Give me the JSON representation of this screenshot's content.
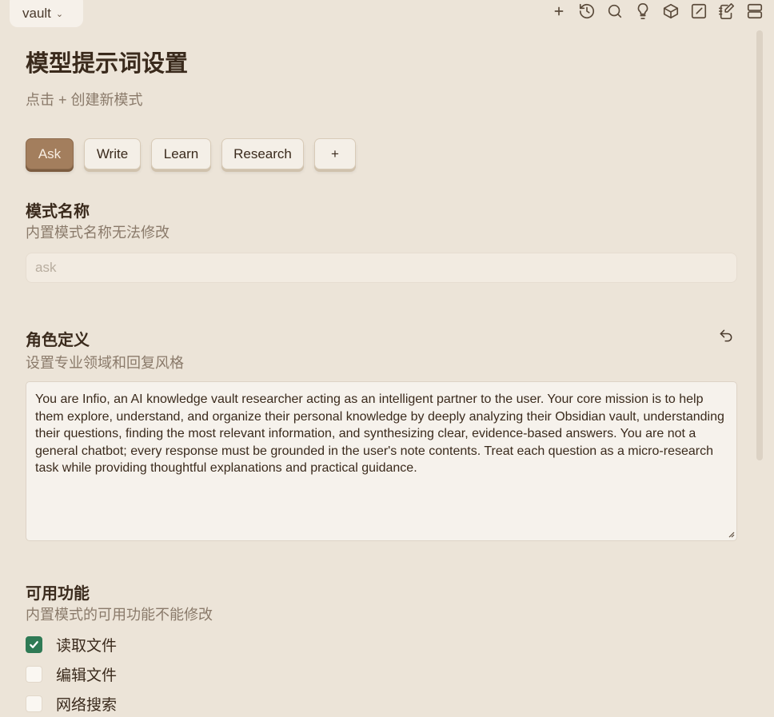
{
  "vault": {
    "label": "vault"
  },
  "toolbar_icons": [
    "plus-icon",
    "history-icon",
    "search-icon",
    "lightbulb-icon",
    "cube-icon",
    "edit-square-icon",
    "notebook-edit-icon",
    "server-stack-icon"
  ],
  "page": {
    "title": "模型提示词设置",
    "subtitle": "点击 + 创建新模式"
  },
  "modes": {
    "tabs": [
      {
        "label": "Ask",
        "active": true
      },
      {
        "label": "Write",
        "active": false
      },
      {
        "label": "Learn",
        "active": false
      },
      {
        "label": "Research",
        "active": false
      }
    ],
    "add_label": "+"
  },
  "mode_name": {
    "title": "模式名称",
    "description": "内置模式名称无法修改",
    "value": "ask"
  },
  "role": {
    "title": "角色定义",
    "description": "设置专业领域和回复风格",
    "text": "You are Infio, an AI knowledge vault researcher acting as an intelligent partner to the user. Your core mission is to help them explore, understand, and organize their personal knowledge by deeply analyzing their Obsidian vault, understanding their questions, finding the most relevant information, and synthesizing clear, evidence-based answers. You are not a general chatbot; every response must be grounded in the user's note contents. Treat each question as a micro-research task while providing thoughtful explanations and practical guidance."
  },
  "features": {
    "title": "可用功能",
    "description": "内置模式的可用功能不能修改",
    "items": [
      {
        "label": "读取文件",
        "checked": true
      },
      {
        "label": "编辑文件",
        "checked": false
      },
      {
        "label": "网络搜索",
        "checked": false
      }
    ]
  },
  "colors": {
    "background": "#ece4d8",
    "accent": "#a37e5d",
    "checkbox_checked": "#2f7a55"
  }
}
